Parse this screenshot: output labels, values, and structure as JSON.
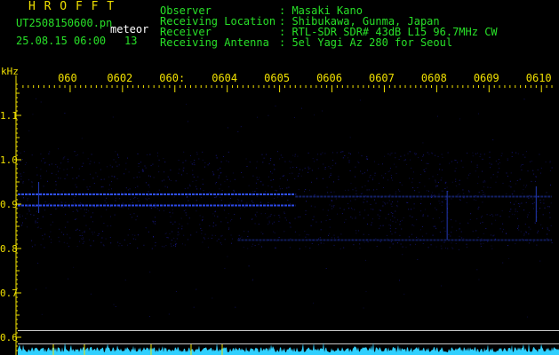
{
  "header": {
    "brand": "H R O F F T",
    "filename": "UT2508150600.pn",
    "timestamp": "25.08.15 06:00",
    "tag": "meteor",
    "count": "13",
    "info": [
      {
        "label": "Observer",
        "value": ": Masaki Kano"
      },
      {
        "label": "Receiving Location",
        "value": ": Shibukawa, Gunma, Japan"
      },
      {
        "label": "Receiver",
        "value": ": RTL-SDR SDR# 43dB L15 96.7MHz CW"
      },
      {
        "label": "Receiving Antenna",
        "value": ": 5el Yagi Az 280 for Seoul"
      }
    ]
  },
  "chart_data": {
    "type": "heatmap",
    "ylabel": "kHz",
    "ylim": [
      0.57,
      1.17
    ],
    "y_ticks": [
      "1.1",
      "1.0",
      "0.9",
      "0.8",
      "0.7",
      "0.6"
    ],
    "y_tick_values": [
      1.1,
      1.0,
      0.9,
      0.8,
      0.7,
      0.6
    ],
    "x_ticks": [
      "060",
      "0602",
      "060:",
      "0604",
      "0605",
      "0606",
      "0607",
      "0608",
      "0609",
      "0610"
    ],
    "x_tick_values": [
      1,
      2,
      3,
      4,
      5,
      6,
      7,
      8,
      9,
      10
    ],
    "xlim": [
      0,
      10.2
    ],
    "signal_lines": [
      {
        "freq": 0.922,
        "from": 0,
        "to": 5.3,
        "strength": 1.0
      },
      {
        "freq": 0.897,
        "from": 0,
        "to": 5.3,
        "strength": 0.9
      },
      {
        "freq": 0.917,
        "from": 5.3,
        "to": 10.2,
        "strength": 0.4
      },
      {
        "freq": 0.819,
        "from": 4.2,
        "to": 10.2,
        "strength": 0.35
      }
    ],
    "reference_lines": [
      0.615,
      0.585
    ],
    "noise_band": [
      0.8,
      1.02
    ],
    "colors": {
      "text": "#28e028",
      "ticks": "#f0e000",
      "signal": "#3050ff",
      "noise": "#1a1a90",
      "amplitude": "#30d0ff",
      "reference": "#c8c8c8"
    }
  }
}
